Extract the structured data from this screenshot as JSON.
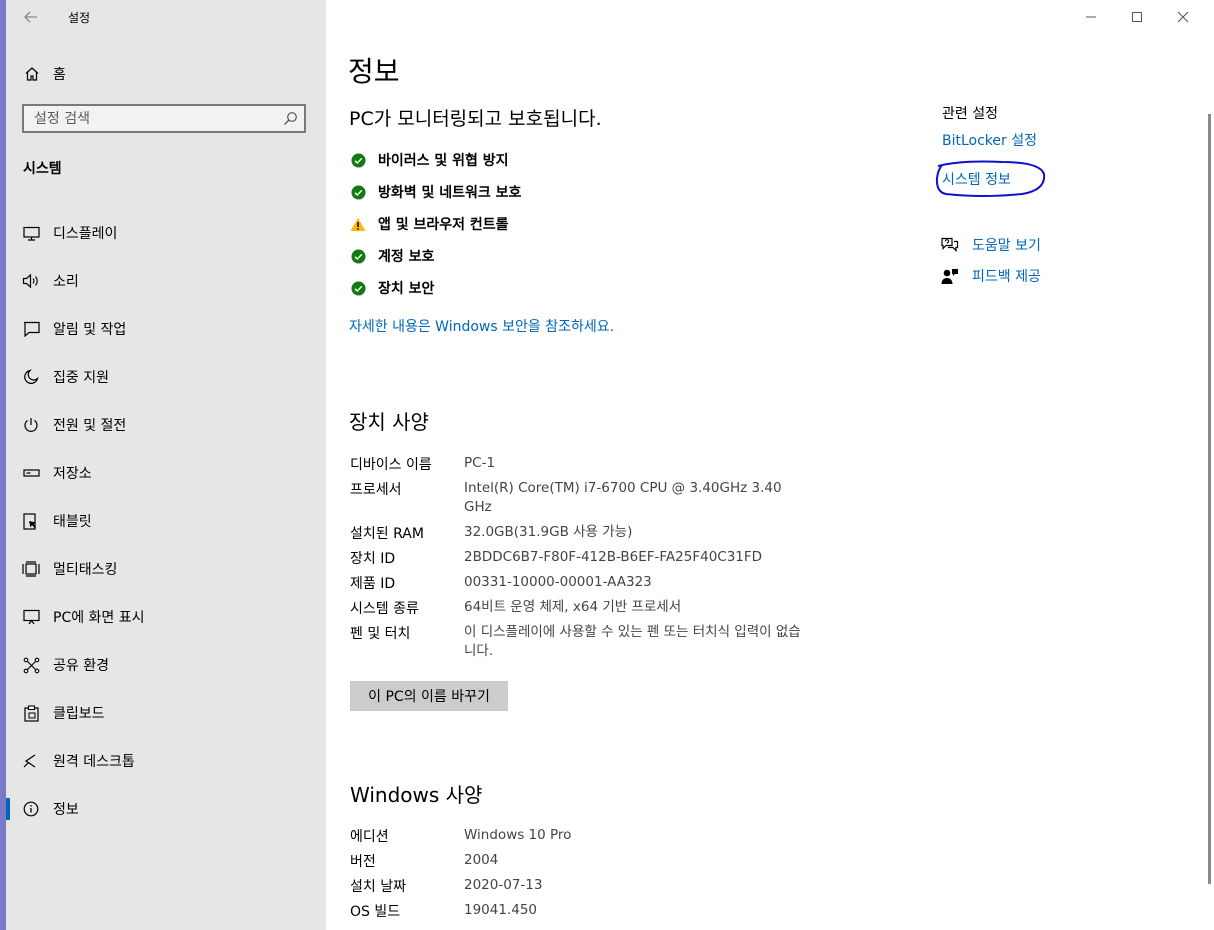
{
  "window": {
    "app_title": "설정",
    "controls": {
      "minimize": "minimize-icon",
      "maximize": "maximize-icon",
      "close": "close-icon"
    }
  },
  "sidebar": {
    "home_label": "홈",
    "search_placeholder": "설정 검색",
    "section_title": "시스템",
    "items": [
      {
        "label": "디스플레이",
        "icon": "display-icon",
        "active": false
      },
      {
        "label": "소리",
        "icon": "speaker-icon",
        "active": false
      },
      {
        "label": "알림 및 작업",
        "icon": "notification-icon",
        "active": false
      },
      {
        "label": "집중 지원",
        "icon": "moon-icon",
        "active": false
      },
      {
        "label": "전원 및 절전",
        "icon": "power-icon",
        "active": false
      },
      {
        "label": "저장소",
        "icon": "storage-icon",
        "active": false
      },
      {
        "label": "태블릿",
        "icon": "tablet-icon",
        "active": false
      },
      {
        "label": "멀티태스킹",
        "icon": "multitasking-icon",
        "active": false
      },
      {
        "label": "PC에 화면 표시",
        "icon": "project-icon",
        "active": false
      },
      {
        "label": "공유 환경",
        "icon": "shared-icon",
        "active": false
      },
      {
        "label": "클립보드",
        "icon": "clipboard-icon",
        "active": false
      },
      {
        "label": "원격 데스크톱",
        "icon": "remote-desktop-icon",
        "active": false
      },
      {
        "label": "정보",
        "icon": "info-icon",
        "active": true
      }
    ]
  },
  "main": {
    "page_title": "정보",
    "protection": {
      "title": "PC가 모니터링되고 보호됩니다.",
      "items": [
        {
          "label": "바이러스 및 위협 방지",
          "status": "ok"
        },
        {
          "label": "방화벽 및 네트워크 보호",
          "status": "ok"
        },
        {
          "label": "앱 및 브라우저 컨트롤",
          "status": "warning"
        },
        {
          "label": "계정 보호",
          "status": "ok"
        },
        {
          "label": "장치 보안",
          "status": "ok"
        }
      ],
      "more_link": "자세한 내용은 Windows 보안을 참조하세요."
    },
    "device_specs": {
      "title": "장치 사양",
      "rows": [
        {
          "key": "디바이스 이름",
          "value": "PC-1"
        },
        {
          "key": "프로세서",
          "value": "Intel(R) Core(TM) i7-6700 CPU @ 3.40GHz   3.40 GHz"
        },
        {
          "key": "설치된 RAM",
          "value": "32.0GB(31.9GB 사용 가능)"
        },
        {
          "key": "장치 ID",
          "value": "2BDDC6B7-F80F-412B-B6EF-FA25F40C31FD"
        },
        {
          "key": "제품 ID",
          "value": "00331-10000-00001-AA323"
        },
        {
          "key": "시스템 종류",
          "value": "64비트 운영 체제, x64 기반 프로세서"
        },
        {
          "key": "펜 및 터치",
          "value": "이 디스플레이에 사용할 수 있는 펜 또는 터치식 입력이 없습니다."
        }
      ],
      "rename_button": "이 PC의 이름 바꾸기"
    },
    "windows_specs": {
      "title": "Windows 사양",
      "rows": [
        {
          "key": "에디션",
          "value": "Windows 10 Pro"
        },
        {
          "key": "버전",
          "value": "2004"
        },
        {
          "key": "설치 날짜",
          "value": "2020-07-13"
        },
        {
          "key": "OS 빌드",
          "value": "19041.450"
        }
      ]
    },
    "related": {
      "title": "관련 설정",
      "links": [
        "BitLocker 설정",
        "시스템 정보"
      ],
      "help": [
        {
          "label": "도움말 보기",
          "icon": "help-chat-icon"
        },
        {
          "label": "피드백 제공",
          "icon": "feedback-icon"
        }
      ]
    }
  },
  "colors": {
    "accent": "#0067b8",
    "sidebar_bg": "#e6e6e6",
    "ok": "#107c10",
    "warning": "#ffb900",
    "annotation": "#1010d0"
  }
}
